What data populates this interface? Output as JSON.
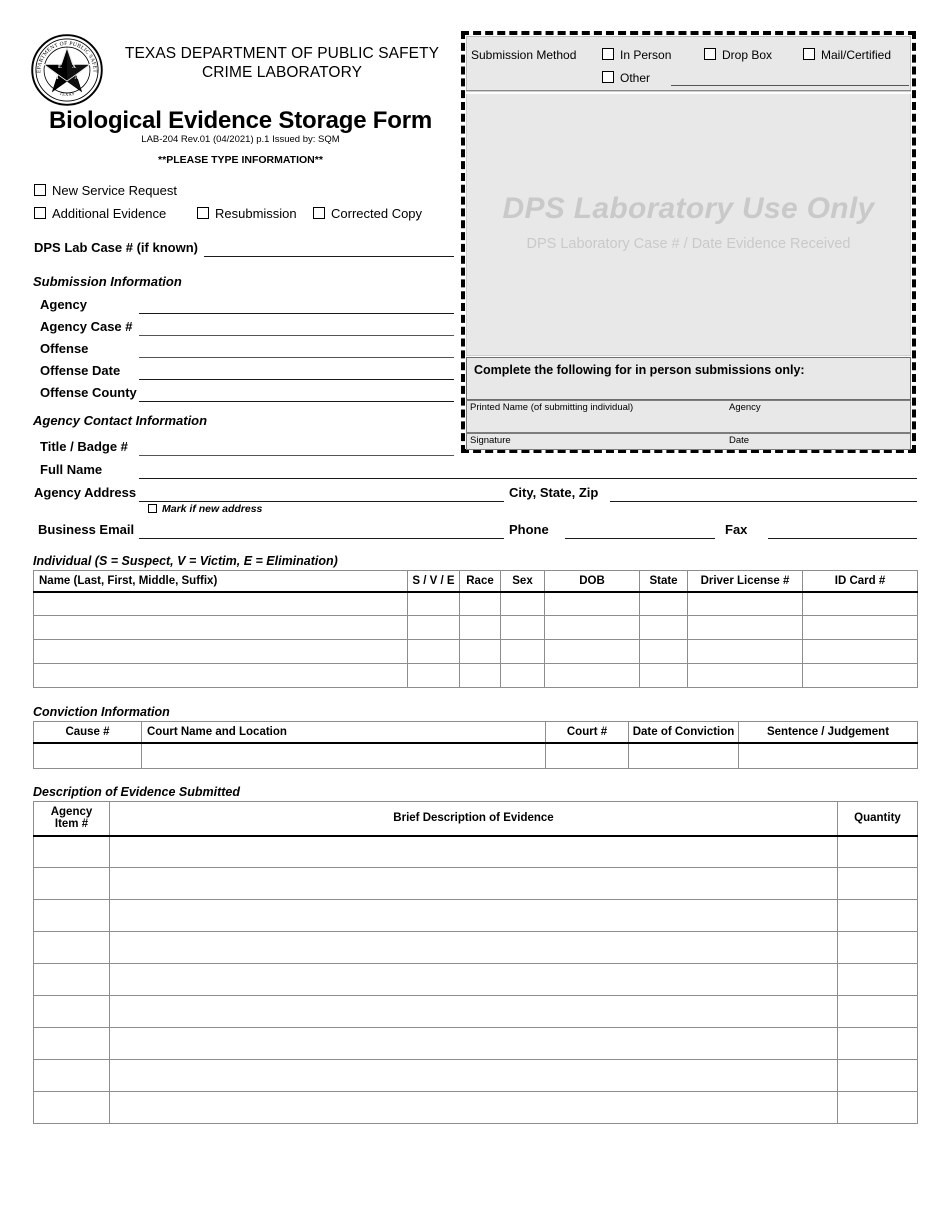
{
  "header": {
    "org_line1": "TEXAS DEPARTMENT OF PUBLIC SAFETY",
    "org_line2": "CRIME LABORATORY",
    "form_title": "Biological Evidence Storage Form",
    "form_rev": "LAB-204 Rev.01 (04/2021) p.1 Issued by: SQM",
    "please_type": "**PLEASE TYPE INFORMATION**",
    "seal_letters": [
      "T",
      "E",
      "X",
      "A",
      "S"
    ],
    "seal_top_text": "Department of Public Safety",
    "seal_bottom_text": "Texas"
  },
  "request_type": {
    "new_service_request": "New Service Request",
    "additional_evidence": "Additional Evidence",
    "resubmission": "Resubmission",
    "corrected_copy": "Corrected Copy"
  },
  "lab_case": {
    "label": "DPS Lab Case # (if known)",
    "value": ""
  },
  "submission_information": {
    "title": "Submission Information",
    "fields": [
      {
        "label": "Agency",
        "value": ""
      },
      {
        "label": "Agency Case #",
        "value": ""
      },
      {
        "label": "Offense",
        "value": ""
      },
      {
        "label": "Offense Date",
        "value": ""
      },
      {
        "label": "Offense County",
        "value": ""
      }
    ]
  },
  "agency_contact": {
    "title": "Agency Contact Information",
    "title_badge": {
      "label": "Title / Badge #",
      "value": ""
    },
    "full_name": {
      "label": "Full Name",
      "value": ""
    },
    "agency_address": {
      "label": "Agency Address",
      "value": ""
    },
    "city_state_zip": {
      "label": "City, State, Zip",
      "value": ""
    },
    "mark_new_address": "Mark if new address",
    "business_email": {
      "label": "Business Email",
      "value": ""
    },
    "phone": {
      "label": "Phone",
      "value": ""
    },
    "fax": {
      "label": "Fax",
      "value": ""
    }
  },
  "dps_box": {
    "submission_method_label": "Submission Method",
    "options": [
      "In Person",
      "Drop Box",
      "Mail/Certified"
    ],
    "other_label": "Other",
    "other_value": "",
    "watermark_main": "DPS Laboratory Use Only",
    "watermark_sub": "DPS Laboratory Case # / Date Evidence Received",
    "in_person_header": "Complete the following for in person submissions only:",
    "printed_name_label": "Printed Name (of submitting individual)",
    "agency_label": "Agency",
    "signature_label": "Signature",
    "date_label": "Date"
  },
  "individual_section": {
    "title": "Individual (S = Suspect, V = Victim, E = Elimination)",
    "columns": [
      "Name (Last, First, Middle, Suffix)",
      "S / V / E",
      "Race",
      "Sex",
      "DOB",
      "State",
      "Driver License #",
      "ID Card #"
    ],
    "rows": [
      [
        "",
        "",
        "",
        "",
        "",
        "",
        "",
        ""
      ],
      [
        "",
        "",
        "",
        "",
        "",
        "",
        "",
        ""
      ],
      [
        "",
        "",
        "",
        "",
        "",
        "",
        "",
        ""
      ],
      [
        "",
        "",
        "",
        "",
        "",
        "",
        "",
        ""
      ]
    ]
  },
  "conviction_section": {
    "title": "Conviction Information",
    "columns": [
      "Cause #",
      "Court Name and Location",
      "Court #",
      "Date of Conviction",
      "Sentence / Judgement"
    ],
    "rows": [
      [
        "",
        "",
        "",
        "",
        ""
      ]
    ]
  },
  "evidence_section": {
    "title": "Description of Evidence Submitted",
    "columns": [
      "Agency\nItem #",
      "Brief Description of Evidence",
      "Quantity"
    ],
    "col_agency_line1": "Agency",
    "col_agency_line2": "Item #",
    "col_description": "Brief Description of Evidence",
    "col_quantity": "Quantity",
    "rows": [
      [
        "",
        "",
        ""
      ],
      [
        "",
        "",
        ""
      ],
      [
        "",
        "",
        ""
      ],
      [
        "",
        "",
        ""
      ],
      [
        "",
        "",
        ""
      ],
      [
        "",
        "",
        ""
      ],
      [
        "",
        "",
        ""
      ],
      [
        "",
        "",
        ""
      ],
      [
        "",
        "",
        ""
      ]
    ]
  },
  "colors": {
    "panel_gray": "#e8e8e8",
    "watermark_gray": "#c9c9c9",
    "rule": "#555555",
    "border": "#8d8d8d"
  }
}
